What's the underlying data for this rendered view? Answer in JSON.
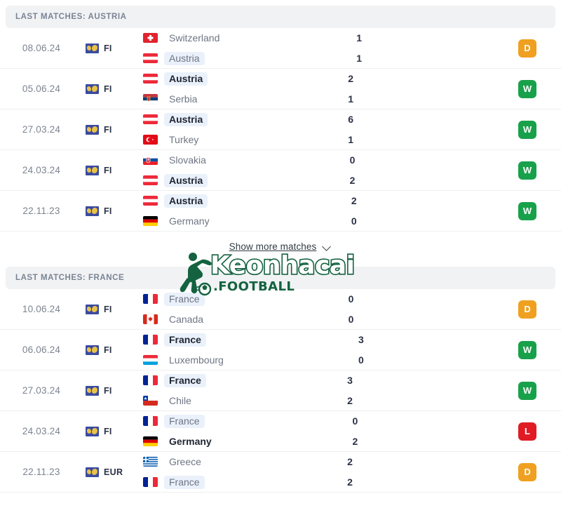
{
  "sections": [
    {
      "id": "austria",
      "header": "LAST MATCHES: AUSTRIA",
      "matches": [
        {
          "date": "08.06.24",
          "competition": "FI",
          "home": {
            "team": "Switzerland",
            "flag": "switzerland",
            "score": "1",
            "bold": false,
            "highlight": false
          },
          "away": {
            "team": "Austria",
            "flag": "austria",
            "score": "1",
            "bold": false,
            "highlight": true
          },
          "result": "D"
        },
        {
          "date": "05.06.24",
          "competition": "FI",
          "home": {
            "team": "Austria",
            "flag": "austria",
            "score": "2",
            "bold": true,
            "highlight": true
          },
          "away": {
            "team": "Serbia",
            "flag": "serbia",
            "score": "1",
            "bold": false,
            "highlight": false
          },
          "result": "W"
        },
        {
          "date": "27.03.24",
          "competition": "FI",
          "home": {
            "team": "Austria",
            "flag": "austria",
            "score": "6",
            "bold": true,
            "highlight": true
          },
          "away": {
            "team": "Turkey",
            "flag": "turkey",
            "score": "1",
            "bold": false,
            "highlight": false
          },
          "result": "W"
        },
        {
          "date": "24.03.24",
          "competition": "FI",
          "home": {
            "team": "Slovakia",
            "flag": "slovakia",
            "score": "0",
            "bold": false,
            "highlight": false
          },
          "away": {
            "team": "Austria",
            "flag": "austria",
            "score": "2",
            "bold": true,
            "highlight": true
          },
          "result": "W"
        },
        {
          "date": "22.11.23",
          "competition": "FI",
          "home": {
            "team": "Austria",
            "flag": "austria",
            "score": "2",
            "bold": true,
            "highlight": true
          },
          "away": {
            "team": "Germany",
            "flag": "germany",
            "score": "0",
            "bold": false,
            "highlight": false
          },
          "result": "W"
        }
      ]
    },
    {
      "id": "france",
      "header": "LAST MATCHES: FRANCE",
      "matches": [
        {
          "date": "10.06.24",
          "competition": "FI",
          "home": {
            "team": "France",
            "flag": "france",
            "score": "0",
            "bold": false,
            "highlight": true
          },
          "away": {
            "team": "Canada",
            "flag": "canada",
            "score": "0",
            "bold": false,
            "highlight": false
          },
          "result": "D"
        },
        {
          "date": "06.06.24",
          "competition": "FI",
          "home": {
            "team": "France",
            "flag": "france",
            "score": "3",
            "bold": true,
            "highlight": true
          },
          "away": {
            "team": "Luxembourg",
            "flag": "luxembourg",
            "score": "0",
            "bold": false,
            "highlight": false
          },
          "result": "W"
        },
        {
          "date": "27.03.24",
          "competition": "FI",
          "home": {
            "team": "France",
            "flag": "france",
            "score": "3",
            "bold": true,
            "highlight": true
          },
          "away": {
            "team": "Chile",
            "flag": "chile",
            "score": "2",
            "bold": false,
            "highlight": false
          },
          "result": "W"
        },
        {
          "date": "24.03.24",
          "competition": "FI",
          "home": {
            "team": "France",
            "flag": "france",
            "score": "0",
            "bold": false,
            "highlight": true
          },
          "away": {
            "team": "Germany",
            "flag": "germany",
            "score": "2",
            "bold": true,
            "highlight": false
          },
          "result": "L"
        },
        {
          "date": "22.11.23",
          "competition": "EUR",
          "home": {
            "team": "Greece",
            "flag": "greece",
            "score": "2",
            "bold": false,
            "highlight": false
          },
          "away": {
            "team": "France",
            "flag": "france",
            "score": "2",
            "bold": false,
            "highlight": true
          },
          "result": "D"
        }
      ]
    }
  ],
  "show_more": {
    "label": "Show more matches",
    "icon": "chevron-down-icon"
  },
  "watermark": {
    "word": "Keonhacai",
    "sub": ".FOOTBALL",
    "color": "#14623f"
  },
  "result_colors": {
    "W": "#18a14a",
    "D": "#f0a020",
    "L": "#e01b24"
  }
}
